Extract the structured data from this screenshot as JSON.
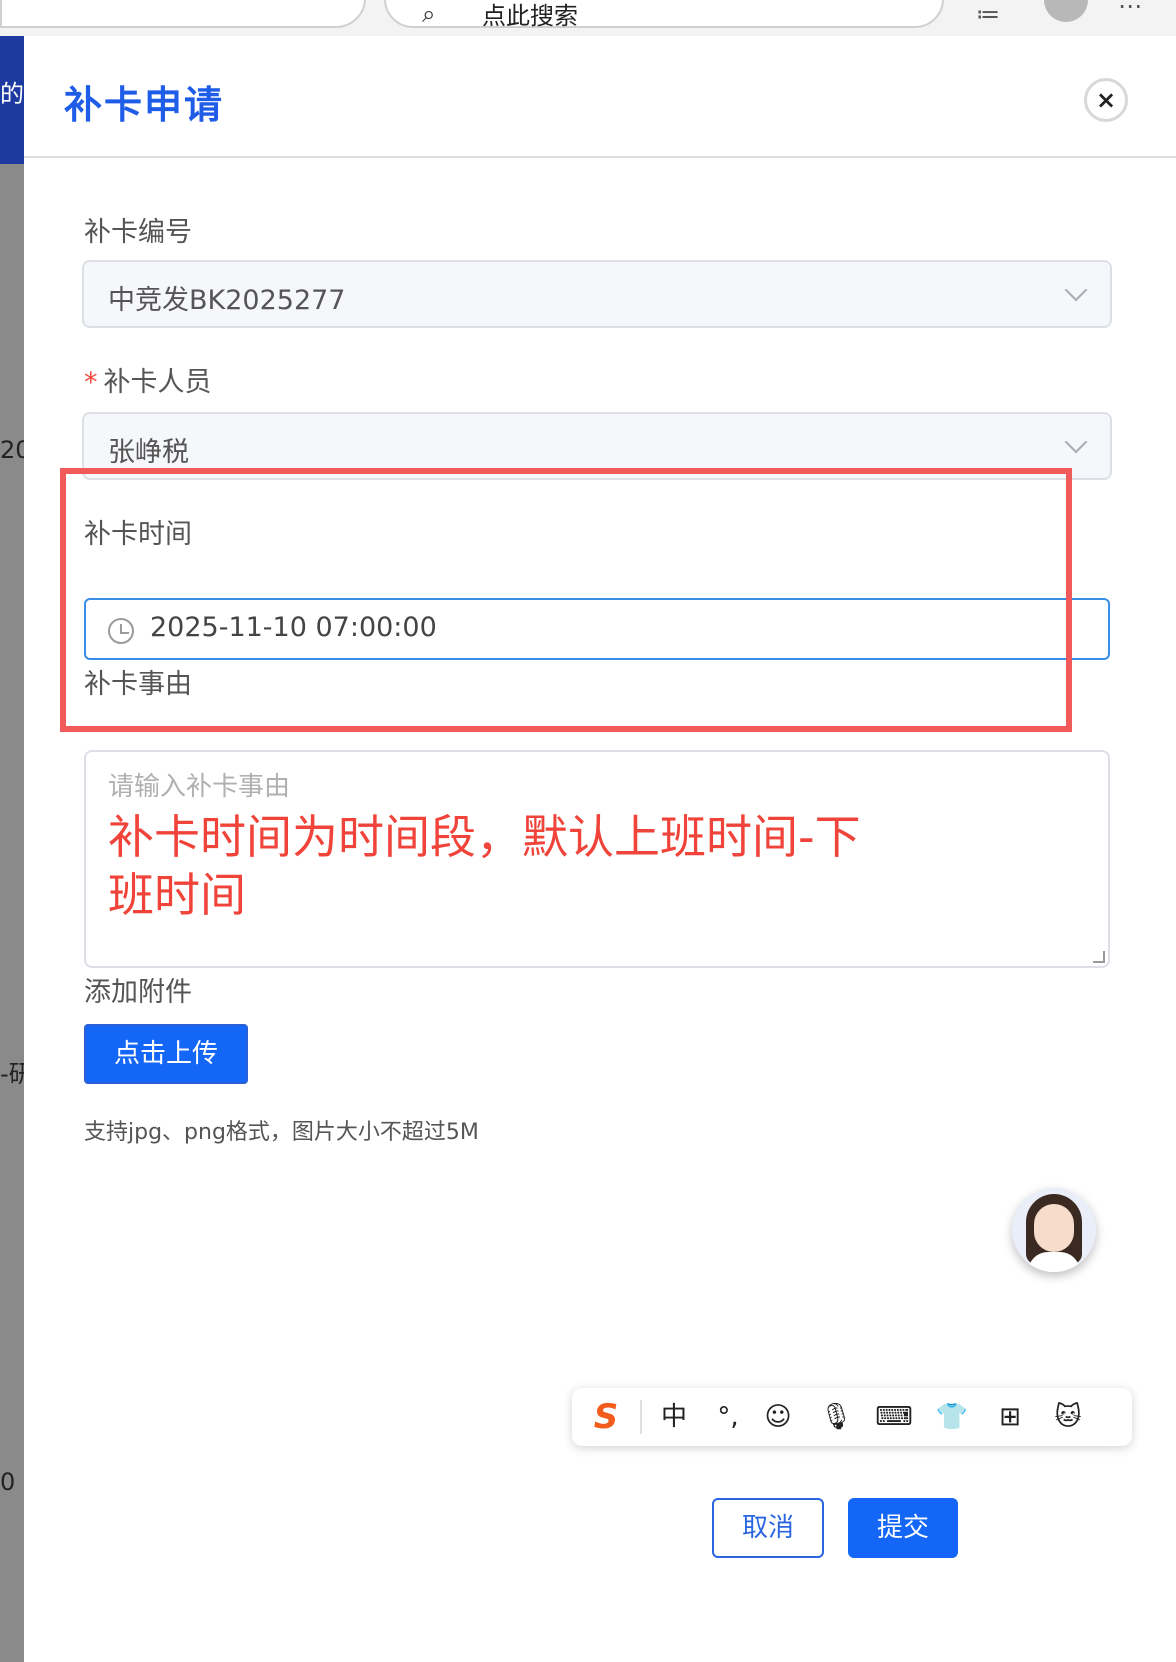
{
  "browser": {
    "search_text": "点此搜索"
  },
  "background_page": {
    "snippets": [
      "的",
      "20",
      "-研",
      "0"
    ]
  },
  "drawer": {
    "title": "补卡申请",
    "close_label": "×",
    "fields": {
      "number": {
        "label": "补卡编号",
        "value": "中竞发BK2025277"
      },
      "person": {
        "required_mark": "*",
        "label": "补卡人员",
        "value": "张峥税"
      },
      "time": {
        "label": "补卡时间",
        "value": "2025-11-10 07:00:00"
      },
      "reason": {
        "label": "补卡事由",
        "placeholder": "请输入补卡事由"
      },
      "attachment": {
        "label": "添加附件",
        "button": "点击上传",
        "hint": "支持jpg、png格式，图片大小不超过5M"
      }
    },
    "annotation": "补卡时间为时间段，默认上班时间-下班时间",
    "footer": {
      "cancel": "取消",
      "submit": "提交"
    }
  },
  "ime_toolbar": {
    "logo": "S",
    "mode": "中",
    "punct": "°,"
  },
  "colors": {
    "primary": "#1466f6",
    "title": "#1f5ce8",
    "annotation": "#f0433a",
    "highlight_border": "#f05a5a",
    "focus_border": "#3a8ee6"
  }
}
